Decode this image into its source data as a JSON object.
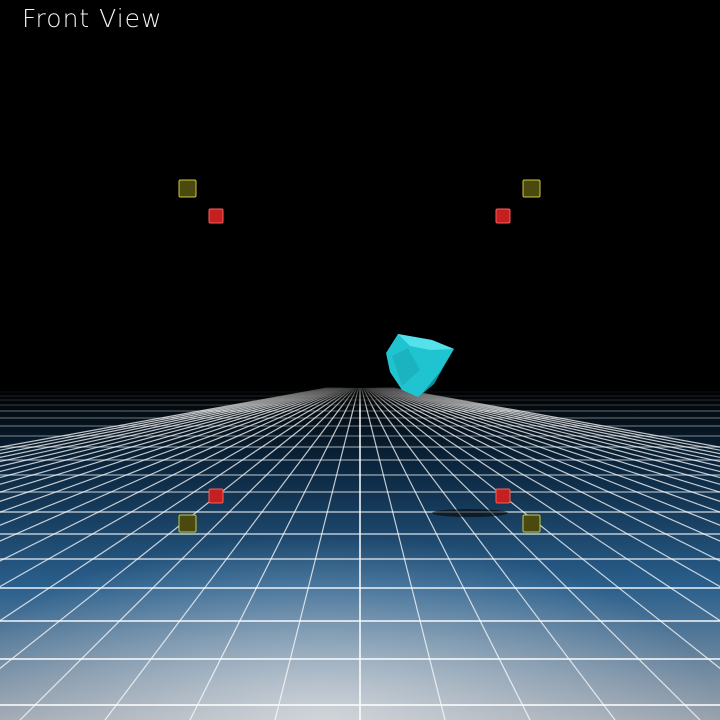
{
  "viewport": {
    "label": "Front View",
    "background_color": "#000000"
  },
  "floor": {
    "grid_line_color": "#ffffff",
    "floor_color_far": "#0b2740",
    "floor_color_near": "#9aa3ad"
  },
  "object": {
    "name": "cyan-rock",
    "color": "#20c4d0",
    "highlight_color": "#5ee6ee",
    "shadow_color": "#0a7f8c"
  },
  "markers": {
    "far_color": "#c32020",
    "near_color": "#4a4a10",
    "near_edge_color": "#c9c93a"
  }
}
